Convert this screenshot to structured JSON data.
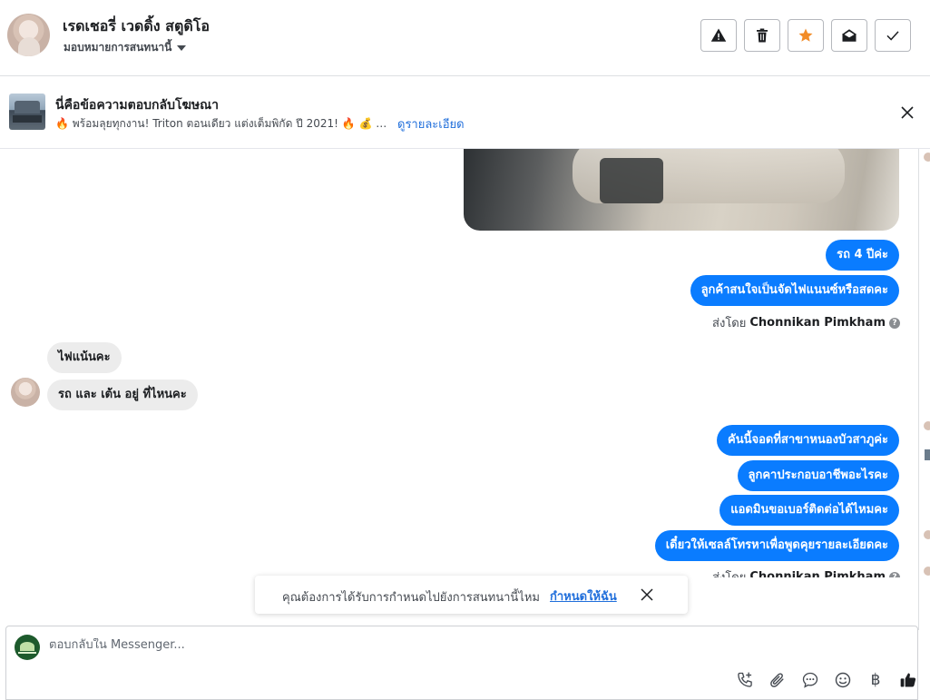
{
  "header": {
    "contact_name": "เรดเชอรี่ เวดดิ้ง สตูดิโอ",
    "assign_label": "มอบหมายการสนทนานี้",
    "buttons": [
      {
        "name": "report-spam-button",
        "icon": "alert-triangle-icon"
      },
      {
        "name": "delete-button",
        "icon": "trash-icon"
      },
      {
        "name": "star-button",
        "icon": "star-icon",
        "color": "#f28c28"
      },
      {
        "name": "mark-unread-button",
        "icon": "envelope-open-icon"
      },
      {
        "name": "mark-done-button",
        "icon": "check-icon"
      }
    ]
  },
  "ad": {
    "title": "นี่คือข้อความตอบกลับโฆษณา",
    "description": "🔥 พร้อมลุยทุกงาน! Triton ตอนเดียว แต่งเต็มพิกัด ปี 2021! 🔥 💰 ราคา...",
    "details_link": "ดูรายละเอียด"
  },
  "messages": {
    "out_group_1": [
      "รถ 4 ปีค่ะ",
      "ลูกค้าสนใจเป็นจัดไฟแนนซ์หรือสดคะ"
    ],
    "sent_by_prefix": "ส่งโดย",
    "sent_by_name": "Chonnikan Pimkham",
    "in_group": [
      "ไฟแน้นคะ",
      "รถ และ เต้น อยู่ ที่ไหนคะ"
    ],
    "out_group_2": [
      "คันนี้จอดที่สาขาหนองบัวสาภูค่ะ",
      "ลูกคาประกอบอาชีพอะไรคะ",
      "แอดมินขอเบอร์ติดต่อได้ไหมคะ",
      "เดี๋ยวให้เซลล์โทรหาเพื่อพูดคุยรายละเอียดคะ"
    ]
  },
  "toast": {
    "text": "คุณต้องการได้รับการกำหนดไปยังการสนทนานี้ไหม",
    "link": "กำหนดให้ฉัน"
  },
  "composer": {
    "placeholder": "ตอบกลับใน Messenger...",
    "tools": [
      "call-add-icon",
      "attachment-icon",
      "saved-replies-icon",
      "emoji-icon",
      "baht-payment-icon",
      "thumbs-up-icon"
    ],
    "baht_symbol": "฿"
  },
  "colors": {
    "outgoing_bubble": "#0a7cff",
    "incoming_bubble": "#ececec",
    "link": "#216fdb",
    "star": "#f28c28"
  }
}
